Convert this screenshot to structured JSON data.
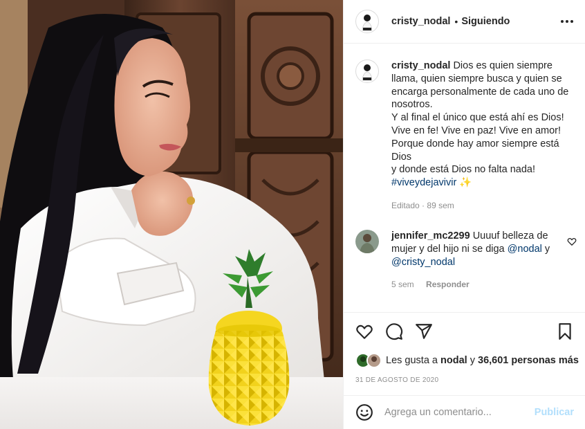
{
  "post": {
    "username": "cristy_nodal",
    "dot": "•",
    "follow_status": "Siguiendo"
  },
  "caption": {
    "username": "cristy_nodal",
    "lines": [
      "Dios es quien siempre llama, quien siempre busca y quien se encarga personalmente de cada uno de nosotros.",
      "Y al final el único que está ahí es Dios!",
      "Vive en fe! Vive en paz! Vive en amor!",
      "Porque donde hay amor siempre está Dios",
      "y donde está Dios no falta nada!"
    ],
    "hashtag": "#viveydejavivir",
    "sparkle": "✨",
    "edited": "Editado",
    "time": "89 sem"
  },
  "comment": {
    "username": "jennifer_mc2299",
    "text_a": "Uuuuf belleza de mujer y del hijo ni se diga",
    "mention_1": "@nodal",
    "text_b": "y",
    "mention_2": "@cristy_nodal",
    "time": "5 sem",
    "reply": "Responder"
  },
  "likes": {
    "prefix": "Les gusta a",
    "liker": "nodal",
    "middle": "y",
    "count": "36,601 personas más"
  },
  "date": "31 DE AGOSTO DE 2020",
  "add_comment": {
    "placeholder": "Agrega un comentario...",
    "publish": "Publicar"
  },
  "icons": {
    "more": "more-options-icon",
    "like": "heart-icon",
    "comment": "comment-icon",
    "share": "paper-plane-icon",
    "save": "bookmark-icon",
    "emoji": "emoji-icon"
  },
  "colors": {
    "text": "#262626",
    "secondary": "#8e8e8e",
    "link": "#00376b",
    "publish_disabled": "#b2dffc",
    "border": "#efefef"
  }
}
